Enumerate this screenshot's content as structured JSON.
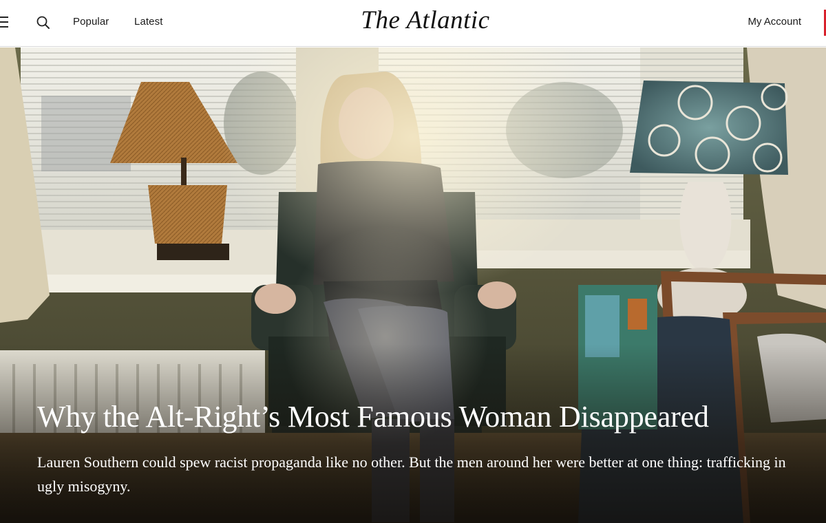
{
  "header": {
    "menu_icon": "hamburger-menu-icon",
    "search_icon": "search-icon",
    "nav": [
      {
        "label": "Popular"
      },
      {
        "label": "Latest"
      }
    ],
    "logo": "The Atlantic",
    "account_label": "My Account",
    "accent_color": "#d8212c"
  },
  "hero": {
    "headline": "Why the Alt-Right’s Most Famous Woman Disappeared",
    "dek": "Lauren Southern could spew racist propaganda like no other. But the men around her were better at one thing: trafficking in ugly misogyny."
  }
}
